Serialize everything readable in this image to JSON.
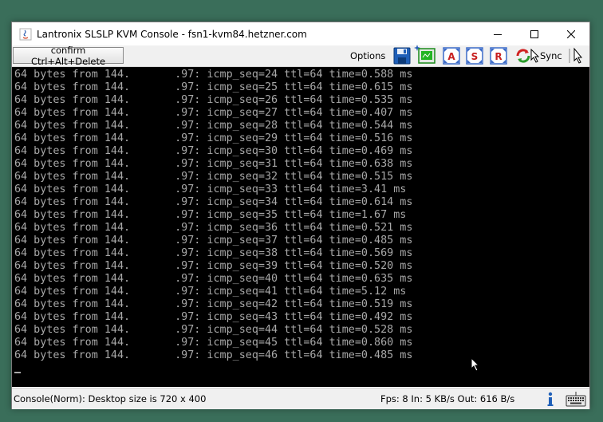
{
  "window": {
    "title": "Lantronix SLSLP KVM Console - fsn1-kvm84.hetzner.com"
  },
  "toolbar": {
    "cad_label": "confirm Ctrl+Alt+Delete",
    "options_label": "Options",
    "sync_label": "Sync",
    "icons": [
      "save-icon",
      "monitor-icon",
      "a-icon",
      "s-icon",
      "r-icon",
      "sync-icon",
      "pointer-icon"
    ]
  },
  "console": {
    "lines": [
      {
        "a": "64 bytes from 144.",
        "b": ".97: icmp_seq=24 ttl=64 time=0.588 ms"
      },
      {
        "a": "64 bytes from 144.",
        "b": ".97: icmp_seq=25 ttl=64 time=0.615 ms"
      },
      {
        "a": "64 bytes from 144.",
        "b": ".97: icmp_seq=26 ttl=64 time=0.535 ms"
      },
      {
        "a": "64 bytes from 144.",
        "b": ".97: icmp_seq=27 ttl=64 time=0.407 ms"
      },
      {
        "a": "64 bytes from 144.",
        "b": ".97: icmp_seq=28 ttl=64 time=0.544 ms"
      },
      {
        "a": "64 bytes from 144.",
        "b": ".97: icmp_seq=29 ttl=64 time=0.516 ms"
      },
      {
        "a": "64 bytes from 144.",
        "b": ".97: icmp_seq=30 ttl=64 time=0.469 ms"
      },
      {
        "a": "64 bytes from 144.",
        "b": ".97: icmp_seq=31 ttl=64 time=0.638 ms"
      },
      {
        "a": "64 bytes from 144.",
        "b": ".97: icmp_seq=32 ttl=64 time=0.515 ms"
      },
      {
        "a": "64 bytes from 144.",
        "b": ".97: icmp_seq=33 ttl=64 time=3.41 ms"
      },
      {
        "a": "64 bytes from 144.",
        "b": ".97: icmp_seq=34 ttl=64 time=0.614 ms"
      },
      {
        "a": "64 bytes from 144.",
        "b": ".97: icmp_seq=35 ttl=64 time=1.67 ms"
      },
      {
        "a": "64 bytes from 144.",
        "b": ".97: icmp_seq=36 ttl=64 time=0.521 ms"
      },
      {
        "a": "64 bytes from 144.",
        "b": ".97: icmp_seq=37 ttl=64 time=0.485 ms"
      },
      {
        "a": "64 bytes from 144.",
        "b": ".97: icmp_seq=38 ttl=64 time=0.569 ms"
      },
      {
        "a": "64 bytes from 144.",
        "b": ".97: icmp_seq=39 ttl=64 time=0.520 ms"
      },
      {
        "a": "64 bytes from 144.",
        "b": ".97: icmp_seq=40 ttl=64 time=0.635 ms"
      },
      {
        "a": "64 bytes from 144.",
        "b": ".97: icmp_seq=41 ttl=64 time=5.12 ms"
      },
      {
        "a": "64 bytes from 144.",
        "b": ".97: icmp_seq=42 ttl=64 time=0.519 ms"
      },
      {
        "a": "64 bytes from 144.",
        "b": ".97: icmp_seq=43 ttl=64 time=0.492 ms"
      },
      {
        "a": "64 bytes from 144.",
        "b": ".97: icmp_seq=44 ttl=64 time=0.528 ms"
      },
      {
        "a": "64 bytes from 144.",
        "b": ".97: icmp_seq=45 ttl=64 time=0.860 ms"
      },
      {
        "a": "64 bytes from 144.",
        "b": ".97: icmp_seq=46 ttl=64 time=0.485 ms"
      }
    ],
    "text_color": "#a8a8a8",
    "background": "#000000"
  },
  "status": {
    "left": "Console(Norm): Desktop size is 720 x 400",
    "right": "Fps: 8 In: 5 KB/s Out: 616 B/s"
  }
}
